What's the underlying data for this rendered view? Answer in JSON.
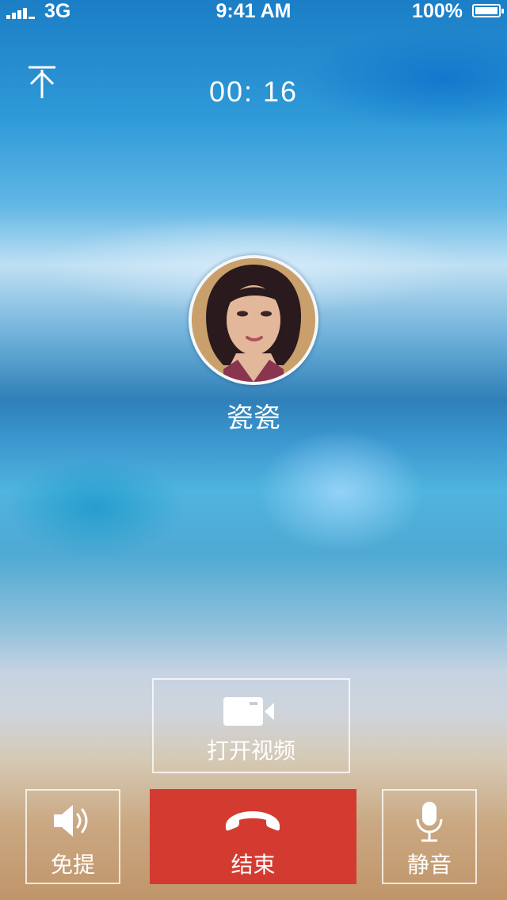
{
  "status_bar": {
    "network": "3G",
    "time": "9:41 AM",
    "battery": "100%"
  },
  "call": {
    "duration": "00:  16",
    "contact_name": "瓷瓷"
  },
  "controls": {
    "video_label": "打开视频",
    "speaker_label": "免提",
    "end_label": "结束",
    "mute_label": "静音"
  },
  "icons": {
    "minimize": "minimize-call-icon",
    "video": "video-camera-icon",
    "speaker": "speaker-icon",
    "end": "hang-up-icon",
    "mute": "microphone-icon"
  },
  "colors": {
    "end_call": "#d33b31"
  }
}
